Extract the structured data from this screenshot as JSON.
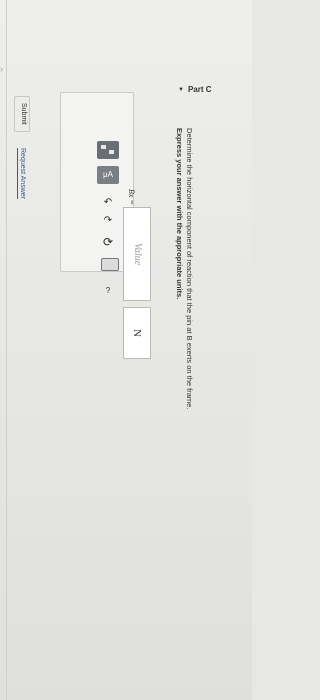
{
  "part": {
    "title": "Part C"
  },
  "question": {
    "line1": "Determine the horizontal component of reaction that the pin at B exerts on the frame.",
    "line2": "Express your answer with the appropriate units."
  },
  "toolbar": {
    "mu_label": "μA",
    "help_label": "?"
  },
  "answer": {
    "variable_label": "Bx =",
    "value_placeholder": "Value",
    "unit_value": "N"
  },
  "actions": {
    "submit_label": "Submit",
    "request_answer_label": "Request Answer"
  }
}
